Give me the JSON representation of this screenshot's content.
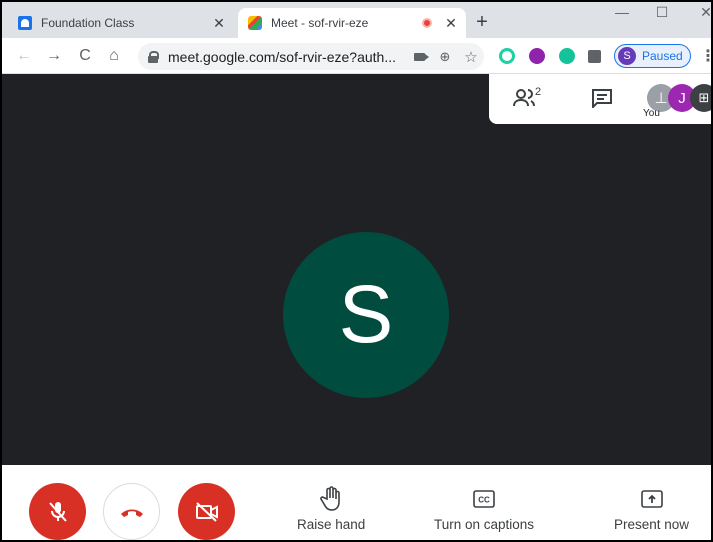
{
  "browser": {
    "tabs": [
      {
        "title": "Foundation Class",
        "favicon": "classroom-icon"
      },
      {
        "title": "Meet - sof-rvir-eze",
        "favicon": "meet-icon",
        "recording": true
      }
    ],
    "url": "meet.google.com/sof-rvir-eze?auth...",
    "profile": {
      "initial": "S",
      "status": "Paused"
    }
  },
  "meet": {
    "people_count": "2",
    "main_avatar_initial": "S",
    "self_tile_initial": "J",
    "self_label": "You",
    "controls": {
      "raise_hand": "Raise hand",
      "captions": "Turn on captions",
      "present": "Present now"
    }
  },
  "colors": {
    "danger": "#d93025",
    "avatar_bg": "#004d40",
    "stage_bg": "#202124",
    "accent": "#1a73e8"
  }
}
